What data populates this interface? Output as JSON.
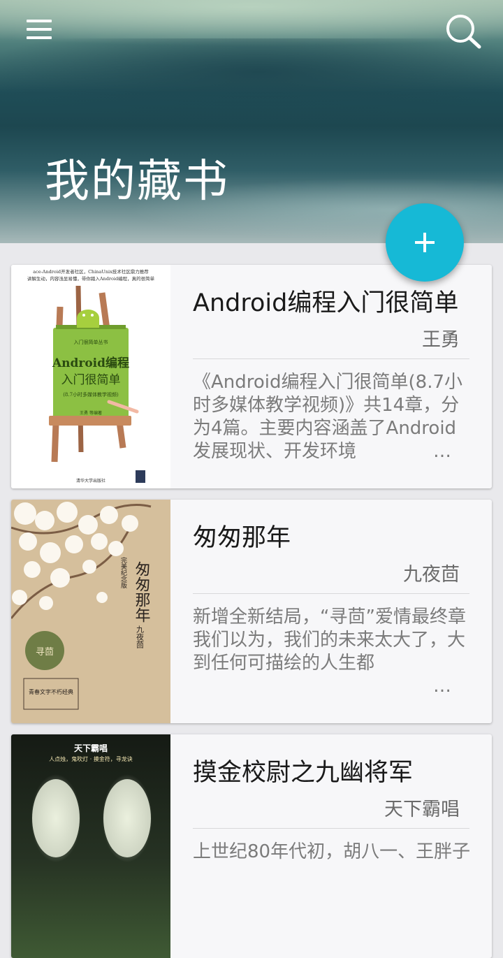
{
  "header": {
    "title": "我的藏书"
  },
  "icons": {
    "menu": "hamburger-menu-icon",
    "search": "search-icon",
    "add": "plus-icon"
  },
  "books": [
    {
      "title": "Android编程入门很简单",
      "author": "王勇",
      "description": "《Android编程入门很简单(8.7小时多媒体教学视频)》共14章，分为4篇。主要内容涵盖了Android发展现状、开发环境",
      "cover": {
        "top_text": "ace-Android开发者社区，ChinaUnix技术社区鼎力推荐",
        "top_text2": "讲解生动，内容浅显易懂，带你踏入Android编程，真的很简单",
        "series": "入门很简单丛书",
        "name_line1": "Android编程",
        "name_line2": "入门很简单",
        "sub": "(8.7小时多媒体教学视频)",
        "authors": "王勇 等编著",
        "publisher": "清华大学出版社"
      }
    },
    {
      "title": "匆匆那年",
      "author": "九夜茴",
      "description": "新增全新结局，“寻茴”爱情最终章\n我们以为，我们的未来太大了，大到任何可描绘的人生都",
      "cover": {
        "name": "匆匆那年",
        "edition": "完美纪念版",
        "author": "九夜茴",
        "badge": "寻茴",
        "blurb": "青春文字不朽经典"
      }
    },
    {
      "title": "摸金校尉之九幽将军",
      "author": "天下霸唱",
      "description": "上世纪80年代初，胡八一、王胖子",
      "cover": {
        "author": "天下霸唱",
        "tagline": "人点烛，鬼吹灯 · 摸金符，寻龙诀"
      }
    }
  ],
  "colors": {
    "accent": "#16b9d6",
    "background": "#e9e9ec",
    "card": "#f7f7f9"
  }
}
